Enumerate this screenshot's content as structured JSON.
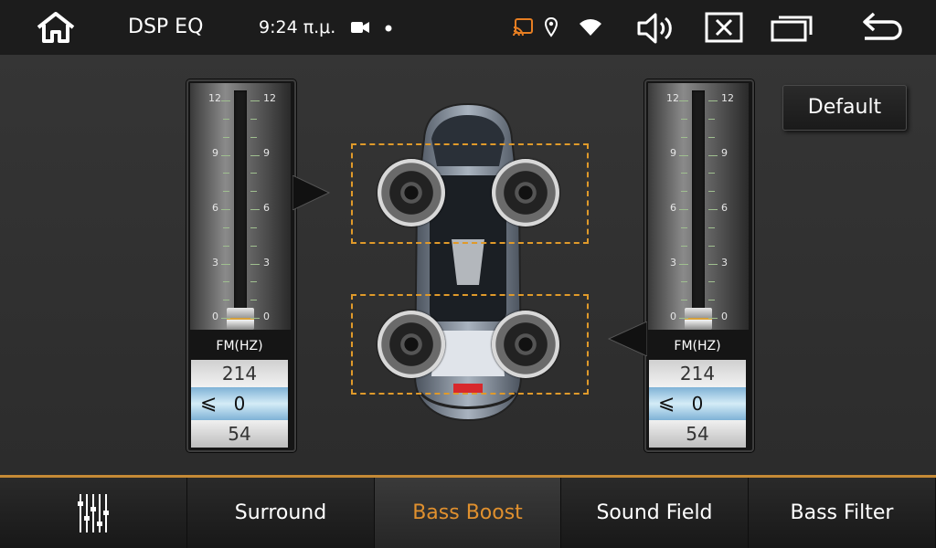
{
  "status_bar": {
    "app_title": "DSP EQ",
    "time": "9:24 π.μ.",
    "icons": [
      "home-icon",
      "video-camera-icon",
      "dot-icon",
      "cast-icon",
      "location-pin-icon",
      "wifi-icon",
      "volume-icon",
      "close-box-icon",
      "recent-apps-icon",
      "back-icon"
    ],
    "accent_color": "#e0902e"
  },
  "left_panel": {
    "scale_labels": [
      "12",
      "9",
      "6",
      "3",
      "0"
    ],
    "level": 0,
    "fm_label": "FM(HZ)",
    "value_above": "214",
    "current_value": "0",
    "value_below": "54",
    "arrow_glyph": "⩽"
  },
  "right_panel": {
    "scale_labels": [
      "12",
      "9",
      "6",
      "3",
      "0"
    ],
    "level": 0,
    "fm_label": "FM(HZ)",
    "value_above": "214",
    "current_value": "0",
    "value_below": "54",
    "arrow_glyph": "⩽"
  },
  "default_button": {
    "label": "Default"
  },
  "car_view": {
    "speakers": [
      "front-left",
      "front-right",
      "rear-left",
      "rear-right"
    ],
    "zone_color": "#e09a2a"
  },
  "bottom_tabs": {
    "eq_icon": "equalizer-icon",
    "items": [
      {
        "label": "Surround",
        "active": false
      },
      {
        "label": "Bass Boost",
        "active": true
      },
      {
        "label": "Sound Field",
        "active": false
      },
      {
        "label": "Bass Filter",
        "active": false
      }
    ]
  }
}
